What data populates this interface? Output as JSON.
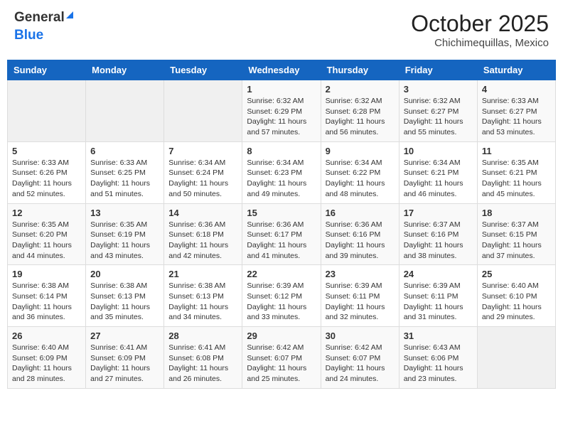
{
  "header": {
    "logo_general": "General",
    "logo_blue": "Blue",
    "month": "October 2025",
    "location": "Chichimequillas, Mexico"
  },
  "weekdays": [
    "Sunday",
    "Monday",
    "Tuesday",
    "Wednesday",
    "Thursday",
    "Friday",
    "Saturday"
  ],
  "weeks": [
    [
      {
        "day": "",
        "sunrise": "",
        "sunset": "",
        "daylight": ""
      },
      {
        "day": "",
        "sunrise": "",
        "sunset": "",
        "daylight": ""
      },
      {
        "day": "",
        "sunrise": "",
        "sunset": "",
        "daylight": ""
      },
      {
        "day": "1",
        "sunrise": "6:32 AM",
        "sunset": "6:29 PM",
        "daylight": "11 hours and 57 minutes."
      },
      {
        "day": "2",
        "sunrise": "6:32 AM",
        "sunset": "6:28 PM",
        "daylight": "11 hours and 56 minutes."
      },
      {
        "day": "3",
        "sunrise": "6:32 AM",
        "sunset": "6:27 PM",
        "daylight": "11 hours and 55 minutes."
      },
      {
        "day": "4",
        "sunrise": "6:33 AM",
        "sunset": "6:27 PM",
        "daylight": "11 hours and 53 minutes."
      }
    ],
    [
      {
        "day": "5",
        "sunrise": "6:33 AM",
        "sunset": "6:26 PM",
        "daylight": "11 hours and 52 minutes."
      },
      {
        "day": "6",
        "sunrise": "6:33 AM",
        "sunset": "6:25 PM",
        "daylight": "11 hours and 51 minutes."
      },
      {
        "day": "7",
        "sunrise": "6:34 AM",
        "sunset": "6:24 PM",
        "daylight": "11 hours and 50 minutes."
      },
      {
        "day": "8",
        "sunrise": "6:34 AM",
        "sunset": "6:23 PM",
        "daylight": "11 hours and 49 minutes."
      },
      {
        "day": "9",
        "sunrise": "6:34 AM",
        "sunset": "6:22 PM",
        "daylight": "11 hours and 48 minutes."
      },
      {
        "day": "10",
        "sunrise": "6:34 AM",
        "sunset": "6:21 PM",
        "daylight": "11 hours and 46 minutes."
      },
      {
        "day": "11",
        "sunrise": "6:35 AM",
        "sunset": "6:21 PM",
        "daylight": "11 hours and 45 minutes."
      }
    ],
    [
      {
        "day": "12",
        "sunrise": "6:35 AM",
        "sunset": "6:20 PM",
        "daylight": "11 hours and 44 minutes."
      },
      {
        "day": "13",
        "sunrise": "6:35 AM",
        "sunset": "6:19 PM",
        "daylight": "11 hours and 43 minutes."
      },
      {
        "day": "14",
        "sunrise": "6:36 AM",
        "sunset": "6:18 PM",
        "daylight": "11 hours and 42 minutes."
      },
      {
        "day": "15",
        "sunrise": "6:36 AM",
        "sunset": "6:17 PM",
        "daylight": "11 hours and 41 minutes."
      },
      {
        "day": "16",
        "sunrise": "6:36 AM",
        "sunset": "6:16 PM",
        "daylight": "11 hours and 39 minutes."
      },
      {
        "day": "17",
        "sunrise": "6:37 AM",
        "sunset": "6:16 PM",
        "daylight": "11 hours and 38 minutes."
      },
      {
        "day": "18",
        "sunrise": "6:37 AM",
        "sunset": "6:15 PM",
        "daylight": "11 hours and 37 minutes."
      }
    ],
    [
      {
        "day": "19",
        "sunrise": "6:38 AM",
        "sunset": "6:14 PM",
        "daylight": "11 hours and 36 minutes."
      },
      {
        "day": "20",
        "sunrise": "6:38 AM",
        "sunset": "6:13 PM",
        "daylight": "11 hours and 35 minutes."
      },
      {
        "day": "21",
        "sunrise": "6:38 AM",
        "sunset": "6:13 PM",
        "daylight": "11 hours and 34 minutes."
      },
      {
        "day": "22",
        "sunrise": "6:39 AM",
        "sunset": "6:12 PM",
        "daylight": "11 hours and 33 minutes."
      },
      {
        "day": "23",
        "sunrise": "6:39 AM",
        "sunset": "6:11 PM",
        "daylight": "11 hours and 32 minutes."
      },
      {
        "day": "24",
        "sunrise": "6:39 AM",
        "sunset": "6:11 PM",
        "daylight": "11 hours and 31 minutes."
      },
      {
        "day": "25",
        "sunrise": "6:40 AM",
        "sunset": "6:10 PM",
        "daylight": "11 hours and 29 minutes."
      }
    ],
    [
      {
        "day": "26",
        "sunrise": "6:40 AM",
        "sunset": "6:09 PM",
        "daylight": "11 hours and 28 minutes."
      },
      {
        "day": "27",
        "sunrise": "6:41 AM",
        "sunset": "6:09 PM",
        "daylight": "11 hours and 27 minutes."
      },
      {
        "day": "28",
        "sunrise": "6:41 AM",
        "sunset": "6:08 PM",
        "daylight": "11 hours and 26 minutes."
      },
      {
        "day": "29",
        "sunrise": "6:42 AM",
        "sunset": "6:07 PM",
        "daylight": "11 hours and 25 minutes."
      },
      {
        "day": "30",
        "sunrise": "6:42 AM",
        "sunset": "6:07 PM",
        "daylight": "11 hours and 24 minutes."
      },
      {
        "day": "31",
        "sunrise": "6:43 AM",
        "sunset": "6:06 PM",
        "daylight": "11 hours and 23 minutes."
      },
      {
        "day": "",
        "sunrise": "",
        "sunset": "",
        "daylight": ""
      }
    ]
  ],
  "labels": {
    "sunrise": "Sunrise:",
    "sunset": "Sunset:",
    "daylight": "Daylight:"
  }
}
